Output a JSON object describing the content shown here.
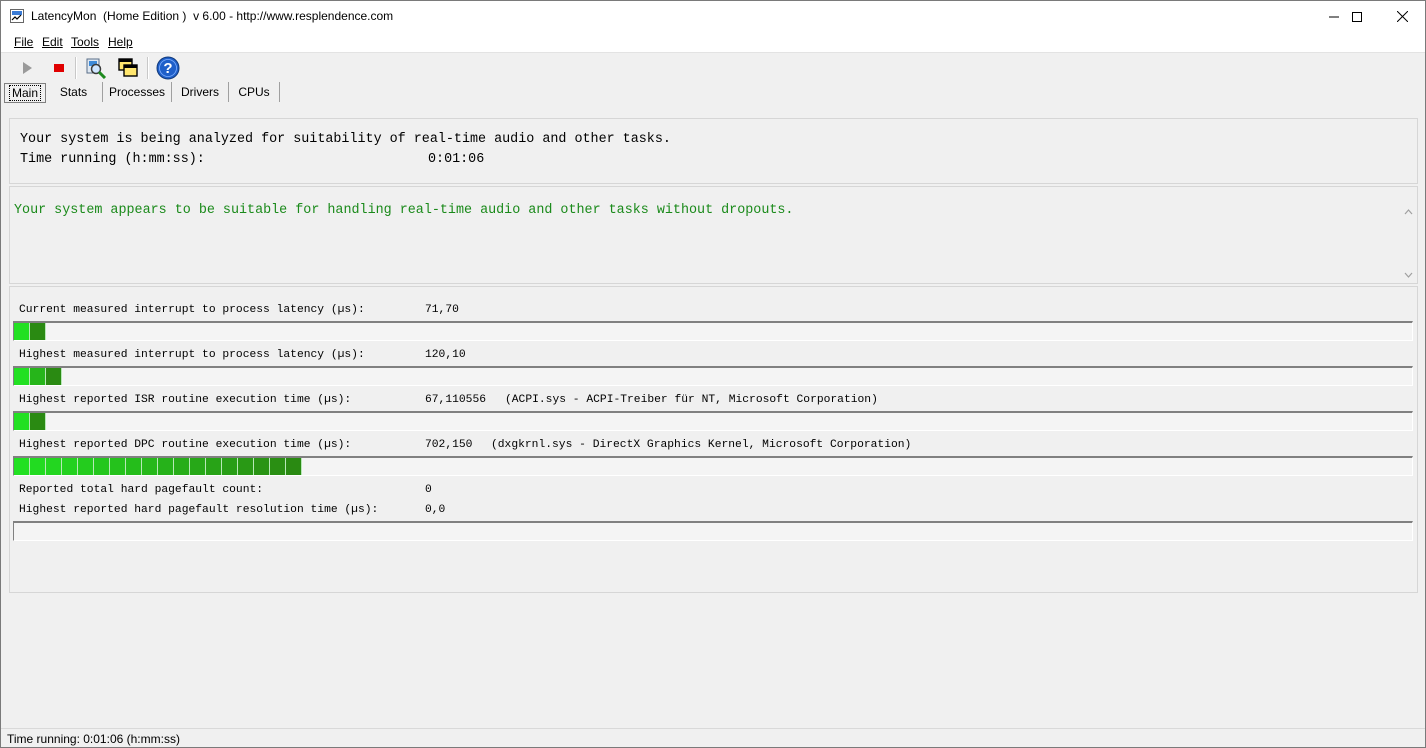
{
  "window": {
    "title": "LatencyMon  (Home Edition )  v 6.00 - http://www.resplendence.com",
    "icon": "latencymon-app-icon"
  },
  "menu": [
    {
      "id": "file",
      "label": "File"
    },
    {
      "id": "edit",
      "label": "Edit"
    },
    {
      "id": "tools",
      "label": "Tools"
    },
    {
      "id": "help",
      "label": "Help"
    }
  ],
  "toolbar": {
    "buttons": [
      {
        "id": "start",
        "icon": "play-icon"
      },
      {
        "id": "stop",
        "icon": "stop-icon",
        "color": "#e00000"
      },
      {
        "id": "analyze",
        "icon": "magnifier-icon"
      },
      {
        "id": "windows",
        "icon": "windows-icon"
      },
      {
        "id": "help",
        "icon": "help-icon",
        "color": "#1f5fc9"
      }
    ]
  },
  "tabs": [
    {
      "id": "main",
      "label": "Main",
      "active": true
    },
    {
      "id": "stats",
      "label": "Stats",
      "active": false
    },
    {
      "id": "processes",
      "label": "Processes",
      "active": false
    },
    {
      "id": "drivers",
      "label": "Drivers",
      "active": false
    },
    {
      "id": "cpus",
      "label": "CPUs",
      "active": false
    }
  ],
  "summary": {
    "line1": "Your system is being analyzed for suitability of real-time audio and other tasks.",
    "time_label": "Time running (h:mm:ss):",
    "time_value": "0:01:06"
  },
  "verdict": {
    "text": "Your system appears to be suitable for handling real-time audio and other tasks without dropouts.",
    "color": "#1a8a1a"
  },
  "metrics": [
    {
      "id": "current-latency",
      "label": "Current measured interrupt to process latency (µs):",
      "value": "71,70",
      "detail": "",
      "bar_fraction": 0.02
    },
    {
      "id": "highest-latency",
      "label": "Highest measured interrupt to process latency (µs):",
      "value": "120,10",
      "detail": "",
      "bar_fraction": 0.032
    },
    {
      "id": "isr-time",
      "label": "Highest reported ISR routine execution time (µs):",
      "value": "67,110556",
      "detail": "(ACPI.sys - ACPI-Treiber für NT, Microsoft Corporation)",
      "bar_fraction": 0.02
    },
    {
      "id": "dpc-time",
      "label": "Highest reported DPC routine execution time (µs):",
      "value": "702,150",
      "detail": "(dxgkrnl.sys - DirectX Graphics Kernel, Microsoft Corporation)",
      "bar_fraction": 0.204
    },
    {
      "id": "pagefault-count",
      "label": "Reported total hard pagefault count:",
      "value": "0",
      "detail": ""
    },
    {
      "id": "pagefault-time",
      "label": "Highest reported hard pagefault resolution time (µs):",
      "value": "0,0",
      "detail": "",
      "bar_fraction": 0
    }
  ],
  "status_bar": {
    "text": "Time running: 0:01:06  (h:mm:ss)"
  },
  "colors": {
    "bar_green_light": "#22e022",
    "bar_green_dark": "#2a8a12"
  }
}
